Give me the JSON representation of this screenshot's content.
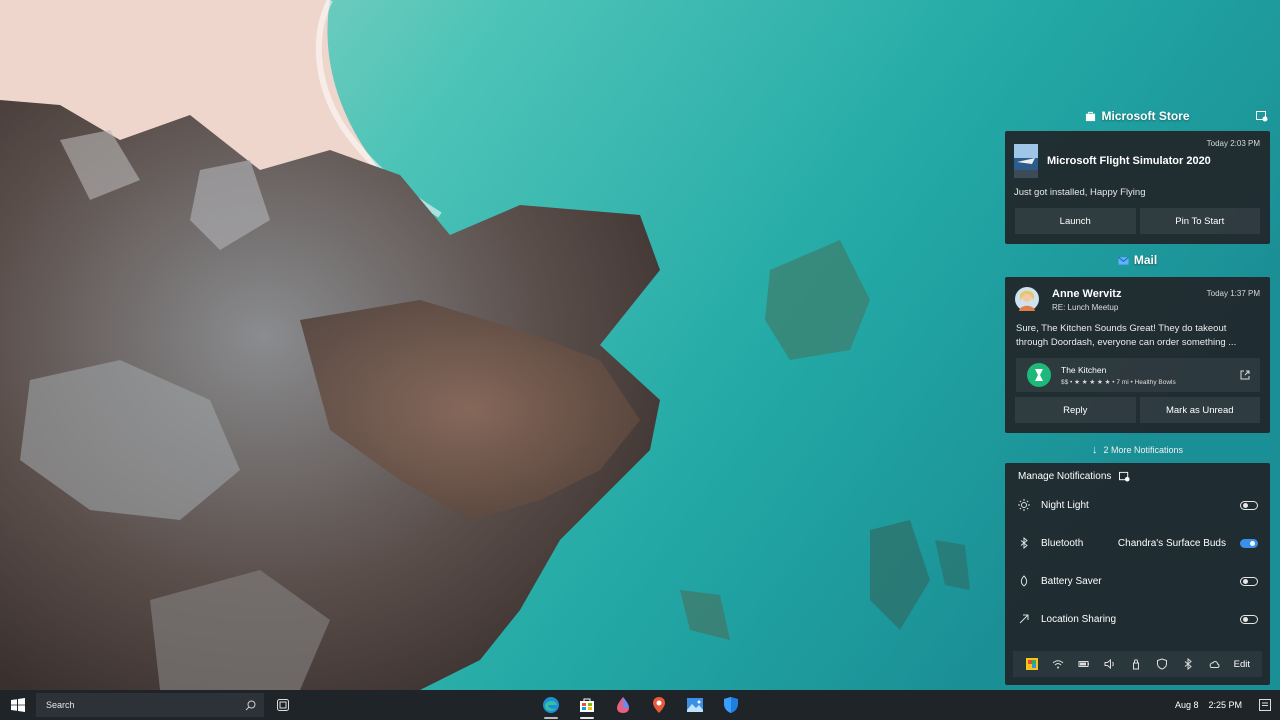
{
  "colors": {
    "accent": "#3a8fe8",
    "panel": "#20262a",
    "taskbar": "#1f2428",
    "sea": "#2aa6a2",
    "sand": "#efd8cf"
  },
  "store_group": {
    "title": "Microsoft Store",
    "icon": "store-icon",
    "settings_icon": "notification-settings-icon"
  },
  "store_card": {
    "time": "Today 2:03 PM",
    "app_title": "Microsoft Flight Simulator 2020",
    "message": "Just got installed, Happy Flying",
    "buttons": [
      "Launch",
      "Pin To Start"
    ]
  },
  "mail_group": {
    "title": "Mail",
    "icon": "mail-icon"
  },
  "mail_card": {
    "sender": "Anne Wervitz",
    "subject": "RE: Lunch Meetup",
    "time": "Today 1:37 PM",
    "body": "Sure, The Kitchen Sounds Great! They do takeout through Doordash, everyone can order something ...",
    "place": {
      "name": "The Kitchen",
      "details": "$$ • ★ ★ ★ ★ ★ • 7 mi • Healthy Bowls"
    },
    "buttons": [
      "Reply",
      "Mark as Unread"
    ]
  },
  "more_notifications": "2 More Notifications",
  "quick_settings": {
    "title": "Manage Notifications",
    "items": [
      {
        "icon": "night-light-icon",
        "label": "Night Light",
        "status": "",
        "on": false
      },
      {
        "icon": "bluetooth-icon",
        "label": "Bluetooth",
        "status": "Chandra's Surface Buds",
        "on": true
      },
      {
        "icon": "battery-saver-icon",
        "label": "Battery Saver",
        "status": "",
        "on": false
      },
      {
        "icon": "location-icon",
        "label": "Location Sharing",
        "status": "",
        "on": false
      }
    ],
    "tray_icons": [
      "color-icon",
      "wifi-icon",
      "battery-icon",
      "volume-icon",
      "lock-icon",
      "shield-icon",
      "bluetooth-icon",
      "cloud-icon"
    ],
    "edit_label": "Edit"
  },
  "taskbar": {
    "search_placeholder": "Search",
    "apps": [
      "edge-icon",
      "store-icon",
      "paint-icon",
      "maps-icon",
      "photos-icon",
      "defender-icon"
    ],
    "date": "Aug 8",
    "time": "2:25 PM"
  }
}
